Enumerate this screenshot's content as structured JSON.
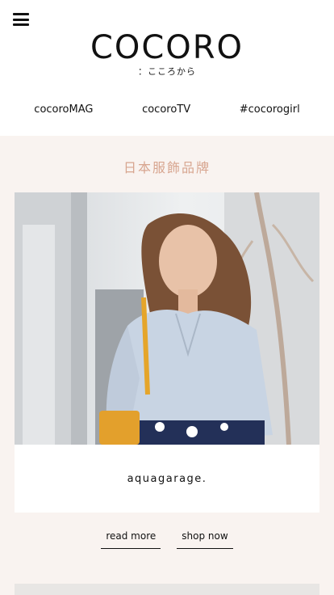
{
  "header": {
    "logo": "COCORO",
    "tagline": "：こころから",
    "nav": [
      "cocoroMAG",
      "cocoroTV",
      "#cocorogirl"
    ]
  },
  "section": {
    "title": "日本服飾品牌"
  },
  "card": {
    "brand": "aquagarage.",
    "links": [
      "read more",
      "shop now"
    ]
  }
}
